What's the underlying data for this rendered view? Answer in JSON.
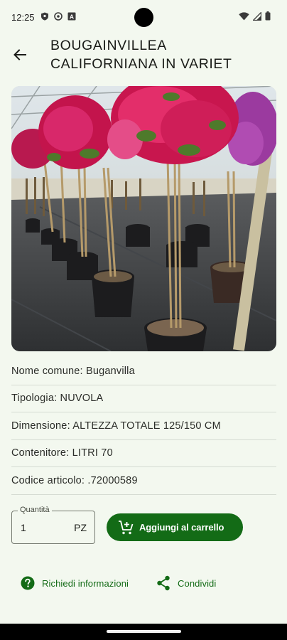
{
  "status_bar": {
    "time": "12:25",
    "left_icons": [
      "shield-icon",
      "sync-icon",
      "font-icon"
    ],
    "right_icons": [
      "wifi-icon",
      "signal-icon",
      "battery-icon"
    ]
  },
  "header": {
    "title": "BOUGAINVILLEA\nCALIFORNIANA IN VARIET",
    "back_icon": "arrow-back-icon"
  },
  "product": {
    "image_description": "bougainvillea-tree-photo",
    "details": [
      {
        "label": "Nome comune: Buganvilla"
      },
      {
        "label": "Tipologia: NUVOLA"
      },
      {
        "label": "Dimensione: ALTEZZA TOTALE 125/150 CM"
      },
      {
        "label": "Contenitore: LITRI 70"
      },
      {
        "label": "Codice articolo: .72000589"
      }
    ]
  },
  "quantity": {
    "label": "Quantità",
    "value": "1",
    "unit": "PZ"
  },
  "actions": {
    "add_to_cart": "Aggiungi al carrello",
    "request_info": "Richiedi informazioni",
    "share": "Condividi"
  },
  "colors": {
    "primary": "#136b16",
    "background": "#f3f8ef"
  }
}
